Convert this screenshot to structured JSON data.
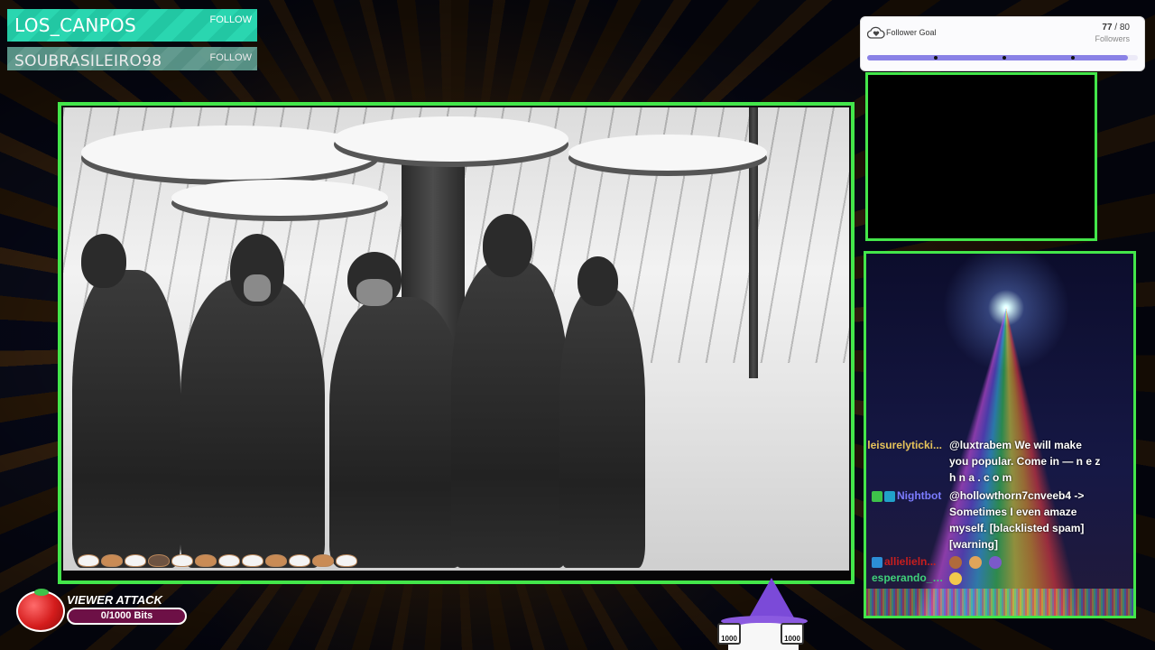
{
  "follow_alerts": [
    {
      "name": "LOS_CANPOS",
      "action": "FOLLOW"
    },
    {
      "name": "SOUBRASILEIRO98",
      "action": "FOLLOW"
    }
  ],
  "follower_goal": {
    "label": "Follower Goal",
    "current": "77",
    "separator": " / ",
    "target": "80",
    "unit": "Followers",
    "progress_fraction": 0.9625
  },
  "chat": {
    "messages": [
      {
        "user": "leisurelyticki...",
        "user_color": "#e6c35a",
        "text": "@luxtrabem We will make you popular. Come in — n e z h n a . c o m"
      },
      {
        "user": "Nightbot",
        "user_color": "#7c7cff",
        "text": "@hollowthorn7cnveeb4 -> Sometimes I even amaze myself. [blacklisted spam] [warning]"
      },
      {
        "user": "allielieln...",
        "user_color": "#c81e1e",
        "text": ""
      },
      {
        "user": "esperando_s...",
        "user_color": "#3fd17a",
        "text": ""
      }
    ]
  },
  "viewer_attack": {
    "title": "VIEWER ATTACK",
    "progress_text": "0/1000 Bits"
  },
  "mascot": {
    "left_box": "1000",
    "right_box": "1000"
  },
  "colors": {
    "frame_green": "#43e64a",
    "follow_teal": "#2ad6b0",
    "goal_fill": "#8a82e6",
    "attack_bar": "#6d1046"
  },
  "icons": [
    "cloud-heart-icon",
    "tomato-icon",
    "wizard-cat-mascot",
    "moderator-badge-icon",
    "bot-badge-icon"
  ]
}
